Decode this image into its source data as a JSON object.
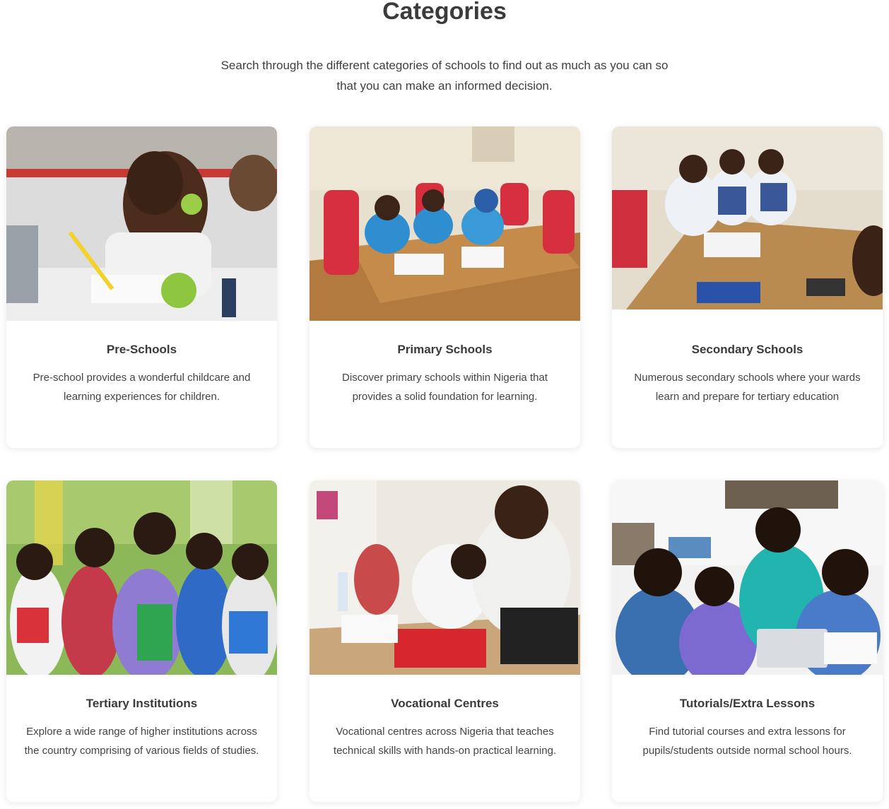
{
  "section": {
    "title": "Categories",
    "subtitle": "Search through the different categories of schools to find out as much as you can so that you can make an informed decision."
  },
  "categories": [
    {
      "title": "Pre-Schools",
      "description": "Pre-school provides a wonderful childcare and learning experiences for children.",
      "image_icon": "preschool-photo"
    },
    {
      "title": "Primary Schools",
      "description": "Discover primary schools within Nigeria that provides a solid foundation for learning.",
      "image_icon": "primary-school-photo"
    },
    {
      "title": "Secondary Schools",
      "description": "Numerous secondary schools where your wards learn and prepare for tertiary education",
      "image_icon": "secondary-school-photo"
    },
    {
      "title": "Tertiary Institutions",
      "description": "Explore a wide range of higher institutions across the country comprising of various fields of studies.",
      "image_icon": "tertiary-students-photo"
    },
    {
      "title": "Vocational Centres",
      "description": "Vocational centres across Nigeria that teaches technical skills with hands-on practical learning.",
      "image_icon": "vocational-workshop-photo"
    },
    {
      "title": "Tutorials/Extra Lessons",
      "description": "Find tutorial courses and extra lessons for pupils/students outside normal school hours.",
      "image_icon": "tutorial-lesson-photo"
    }
  ],
  "colors": {
    "text": "#3a3a3a",
    "card_background": "#ffffff"
  }
}
